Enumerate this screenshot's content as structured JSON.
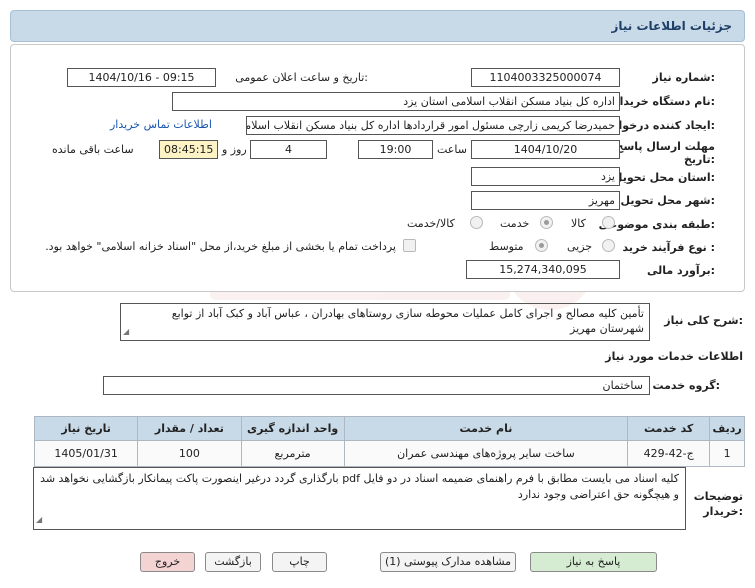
{
  "header": {
    "title": "جزئیات اطلاعات نیاز"
  },
  "form": {
    "need_number_label": "شماره نیاز:",
    "need_number": "1104003325000074",
    "announce_label": "تاریخ و ساعت اعلان عمومی:",
    "announce_value": "1404/10/16 - 09:15",
    "buyer_org_label": "نام دستگاه خریدار:",
    "buyer_org": "اداره کل بنیاد مسکن انقلاب اسلامی استان یزد",
    "creator_label": "ایجاد کننده درخواست:",
    "creator": "حمیدرضا کریمی زارچی مسئول امور قراردادها اداره کل بنیاد مسکن انقلاب اسلامی استان یزد",
    "contact_link": "اطلاعات تماس خریدار",
    "deadline_label_1": "مهلت ارسال پاسخ: تا",
    "deadline_label_2": "تاریخ:",
    "deadline_date": "1404/10/20",
    "time_label": "ساعت",
    "deadline_time": "19:00",
    "days_value": "4",
    "days_label": "روز و",
    "remaining_time": "08:45:15",
    "remaining_label": "ساعت باقی مانده",
    "province_label": "استان محل تحویل:",
    "province": "یزد",
    "city_label": "شهر محل تحویل:",
    "city": "مهریز",
    "category_label": "طبقه بندی موضوعی:",
    "category_options": [
      "کالا",
      "خدمت",
      "کالا/خدمت"
    ],
    "category_selected": "خدمت",
    "process_label": "نوع فرآیند خرید :",
    "process_options": [
      "جزیی",
      "متوسط"
    ],
    "process_selected": "متوسط",
    "payment_note": "پرداخت تمام یا بخشی از مبلغ خرید،از محل \"اسناد خزانه اسلامی\" خواهد بود.",
    "estimate_label": "برآورد مالی:",
    "estimate": "15,274,340,095"
  },
  "description": {
    "label": "شرح کلی نیاز:",
    "text": "تأمین کلیه مصالح و اجرای کامل عملیات محوطه سازی روستاهای بهادران ، عباس آباد و کبک آباد از توابع شهرستان مهریز"
  },
  "services": {
    "section_title": "اطلاعات خدمات مورد نیاز",
    "group_label": "گروه خدمت:",
    "group_value": "ساختمان",
    "columns": [
      "ردیف",
      "کد خدمت",
      "نام خدمت",
      "واحد اندازه گیری",
      "تعداد / مقدار",
      "تاریخ نیاز"
    ],
    "rows": [
      [
        "1",
        "ج-42-429",
        "ساخت سایر پروژه‌های مهندسی عمران",
        "مترمربع",
        "100",
        "1405/01/31"
      ]
    ]
  },
  "notes": {
    "label_1": "توضیحات",
    "label_2": "خریدار:",
    "text": "کلیه اسناد می بایست مطابق با فرم راهنمای ضمیمه اسناد در دو فایل pdf بارگذاری گردد درغیر اینصورت  پاکت پیمانکار بازگشایی نخواهد شد و هیچگونه حق اعتراضی وجود ندارد"
  },
  "buttons": {
    "reply": "پاسخ به نیاز",
    "attachments": "مشاهده مدارک پیوستی (1)",
    "print": "چاپ",
    "back": "بازگشت",
    "exit": "خروج"
  },
  "colors": {
    "header_bg": "#c8dae8",
    "link": "#1a56b0",
    "reply_button": "#d6ecd2",
    "exit_button": "#f4d3d3",
    "timer_bg": "#fdf3c4"
  }
}
